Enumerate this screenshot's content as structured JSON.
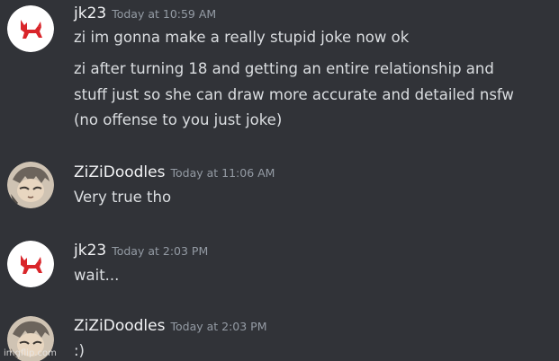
{
  "colors": {
    "background": "#313338",
    "username": "#f2f3f5",
    "timestamp": "#949ba4",
    "message": "#dbdee1",
    "jk23_avatar_bg": "#ffffff",
    "jk23_avatar_icon": "#d9252a"
  },
  "messages": [
    {
      "author": "jk23",
      "timestamp": "Today at 10:59 AM",
      "avatar_icon": "red-fox-icon",
      "lines": [
        "zi im gonna make a really stupid joke now ok",
        "zi after turning 18 and getting an entire relationship and",
        "stuff just so she can draw more accurate and detailed nsfw",
        "(no offense to you just joke)"
      ]
    },
    {
      "author": "ZiZiDoodles",
      "timestamp": "Today at 11:06 AM",
      "avatar_icon": "character-drawing-avatar",
      "lines": [
        "Very true tho"
      ]
    },
    {
      "author": "jk23",
      "timestamp": "Today at 2:03 PM",
      "avatar_icon": "red-fox-icon",
      "lines": [
        "wait..."
      ]
    },
    {
      "author": "ZiZiDoodles",
      "timestamp": "Today at 2:03 PM",
      "avatar_icon": "character-drawing-avatar",
      "lines": [
        ":)"
      ]
    }
  ],
  "watermark": "imgflip.com"
}
